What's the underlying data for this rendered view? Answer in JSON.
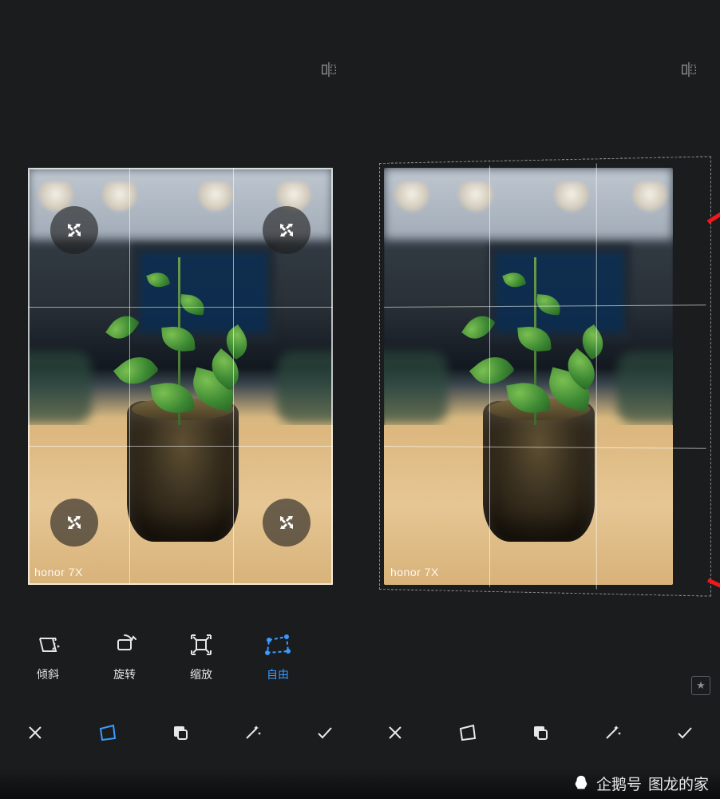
{
  "watermark": "honor 7X",
  "tools": {
    "skew": {
      "label": "倾斜",
      "active": false
    },
    "rotate": {
      "label": "旋转",
      "active": false
    },
    "scale": {
      "label": "缩放",
      "active": false
    },
    "free": {
      "label": "自由",
      "active": true
    }
  },
  "bottombar": {
    "close": {
      "icon": "close-icon"
    },
    "crop": {
      "icon": "crop-skew-icon",
      "active": true
    },
    "layers": {
      "icon": "layers-icon"
    },
    "magic": {
      "icon": "magic-wand-icon"
    },
    "confirm": {
      "icon": "check-icon"
    }
  },
  "rightbar": {
    "close": {
      "icon": "close-icon"
    },
    "crop": {
      "icon": "crop-skew-icon"
    },
    "layers": {
      "icon": "layers-icon"
    },
    "magic": {
      "icon": "magic-wand-icon"
    },
    "confirm": {
      "icon": "check-icon"
    }
  },
  "footer": {
    "source": "企鹅号",
    "author": "图龙的家"
  }
}
